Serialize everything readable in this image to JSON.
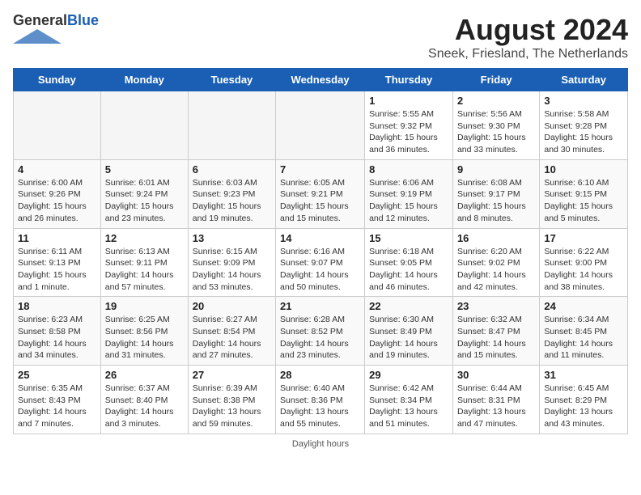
{
  "logo": {
    "general": "General",
    "blue": "Blue"
  },
  "title": "August 2024",
  "subtitle": "Sneek, Friesland, The Netherlands",
  "days_header": [
    "Sunday",
    "Monday",
    "Tuesday",
    "Wednesday",
    "Thursday",
    "Friday",
    "Saturday"
  ],
  "weeks": [
    [
      {
        "day": "",
        "info": ""
      },
      {
        "day": "",
        "info": ""
      },
      {
        "day": "",
        "info": ""
      },
      {
        "day": "",
        "info": ""
      },
      {
        "day": "1",
        "info": "Sunrise: 5:55 AM\nSunset: 9:32 PM\nDaylight: 15 hours and 36 minutes."
      },
      {
        "day": "2",
        "info": "Sunrise: 5:56 AM\nSunset: 9:30 PM\nDaylight: 15 hours and 33 minutes."
      },
      {
        "day": "3",
        "info": "Sunrise: 5:58 AM\nSunset: 9:28 PM\nDaylight: 15 hours and 30 minutes."
      }
    ],
    [
      {
        "day": "4",
        "info": "Sunrise: 6:00 AM\nSunset: 9:26 PM\nDaylight: 15 hours and 26 minutes."
      },
      {
        "day": "5",
        "info": "Sunrise: 6:01 AM\nSunset: 9:24 PM\nDaylight: 15 hours and 23 minutes."
      },
      {
        "day": "6",
        "info": "Sunrise: 6:03 AM\nSunset: 9:23 PM\nDaylight: 15 hours and 19 minutes."
      },
      {
        "day": "7",
        "info": "Sunrise: 6:05 AM\nSunset: 9:21 PM\nDaylight: 15 hours and 15 minutes."
      },
      {
        "day": "8",
        "info": "Sunrise: 6:06 AM\nSunset: 9:19 PM\nDaylight: 15 hours and 12 minutes."
      },
      {
        "day": "9",
        "info": "Sunrise: 6:08 AM\nSunset: 9:17 PM\nDaylight: 15 hours and 8 minutes."
      },
      {
        "day": "10",
        "info": "Sunrise: 6:10 AM\nSunset: 9:15 PM\nDaylight: 15 hours and 5 minutes."
      }
    ],
    [
      {
        "day": "11",
        "info": "Sunrise: 6:11 AM\nSunset: 9:13 PM\nDaylight: 15 hours and 1 minute."
      },
      {
        "day": "12",
        "info": "Sunrise: 6:13 AM\nSunset: 9:11 PM\nDaylight: 14 hours and 57 minutes."
      },
      {
        "day": "13",
        "info": "Sunrise: 6:15 AM\nSunset: 9:09 PM\nDaylight: 14 hours and 53 minutes."
      },
      {
        "day": "14",
        "info": "Sunrise: 6:16 AM\nSunset: 9:07 PM\nDaylight: 14 hours and 50 minutes."
      },
      {
        "day": "15",
        "info": "Sunrise: 6:18 AM\nSunset: 9:05 PM\nDaylight: 14 hours and 46 minutes."
      },
      {
        "day": "16",
        "info": "Sunrise: 6:20 AM\nSunset: 9:02 PM\nDaylight: 14 hours and 42 minutes."
      },
      {
        "day": "17",
        "info": "Sunrise: 6:22 AM\nSunset: 9:00 PM\nDaylight: 14 hours and 38 minutes."
      }
    ],
    [
      {
        "day": "18",
        "info": "Sunrise: 6:23 AM\nSunset: 8:58 PM\nDaylight: 14 hours and 34 minutes."
      },
      {
        "day": "19",
        "info": "Sunrise: 6:25 AM\nSunset: 8:56 PM\nDaylight: 14 hours and 31 minutes."
      },
      {
        "day": "20",
        "info": "Sunrise: 6:27 AM\nSunset: 8:54 PM\nDaylight: 14 hours and 27 minutes."
      },
      {
        "day": "21",
        "info": "Sunrise: 6:28 AM\nSunset: 8:52 PM\nDaylight: 14 hours and 23 minutes."
      },
      {
        "day": "22",
        "info": "Sunrise: 6:30 AM\nSunset: 8:49 PM\nDaylight: 14 hours and 19 minutes."
      },
      {
        "day": "23",
        "info": "Sunrise: 6:32 AM\nSunset: 8:47 PM\nDaylight: 14 hours and 15 minutes."
      },
      {
        "day": "24",
        "info": "Sunrise: 6:34 AM\nSunset: 8:45 PM\nDaylight: 14 hours and 11 minutes."
      }
    ],
    [
      {
        "day": "25",
        "info": "Sunrise: 6:35 AM\nSunset: 8:43 PM\nDaylight: 14 hours and 7 minutes."
      },
      {
        "day": "26",
        "info": "Sunrise: 6:37 AM\nSunset: 8:40 PM\nDaylight: 14 hours and 3 minutes."
      },
      {
        "day": "27",
        "info": "Sunrise: 6:39 AM\nSunset: 8:38 PM\nDaylight: 13 hours and 59 minutes."
      },
      {
        "day": "28",
        "info": "Sunrise: 6:40 AM\nSunset: 8:36 PM\nDaylight: 13 hours and 55 minutes."
      },
      {
        "day": "29",
        "info": "Sunrise: 6:42 AM\nSunset: 8:34 PM\nDaylight: 13 hours and 51 minutes."
      },
      {
        "day": "30",
        "info": "Sunrise: 6:44 AM\nSunset: 8:31 PM\nDaylight: 13 hours and 47 minutes."
      },
      {
        "day": "31",
        "info": "Sunrise: 6:45 AM\nSunset: 8:29 PM\nDaylight: 13 hours and 43 minutes."
      }
    ]
  ],
  "footer": "Daylight hours"
}
